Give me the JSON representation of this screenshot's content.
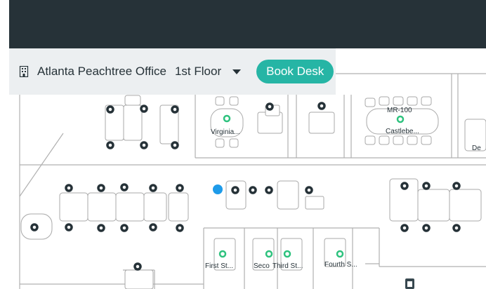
{
  "header": {
    "building_icon": "building-icon",
    "office_name": "Atlanta Peachtree Office",
    "floor": "1st Floor",
    "floor_dropdown_icon": "caret-down-icon",
    "book_desk_label": "Book Desk"
  },
  "colors": {
    "topbar": "#263238",
    "toolbar": "#eceff1",
    "accent": "#26b5a5",
    "available": "#2ec27e",
    "occupied": "#263238",
    "current_user": "#1e9be9"
  },
  "map": {
    "rooms": {
      "virginia": "Virginia...",
      "mr100_code": "MR-100",
      "mr100_name": "Castlebe...",
      "de": "De",
      "first": "First St...",
      "second": "Seco",
      "third": "Third St...",
      "fourth": "Fourth S..."
    }
  }
}
